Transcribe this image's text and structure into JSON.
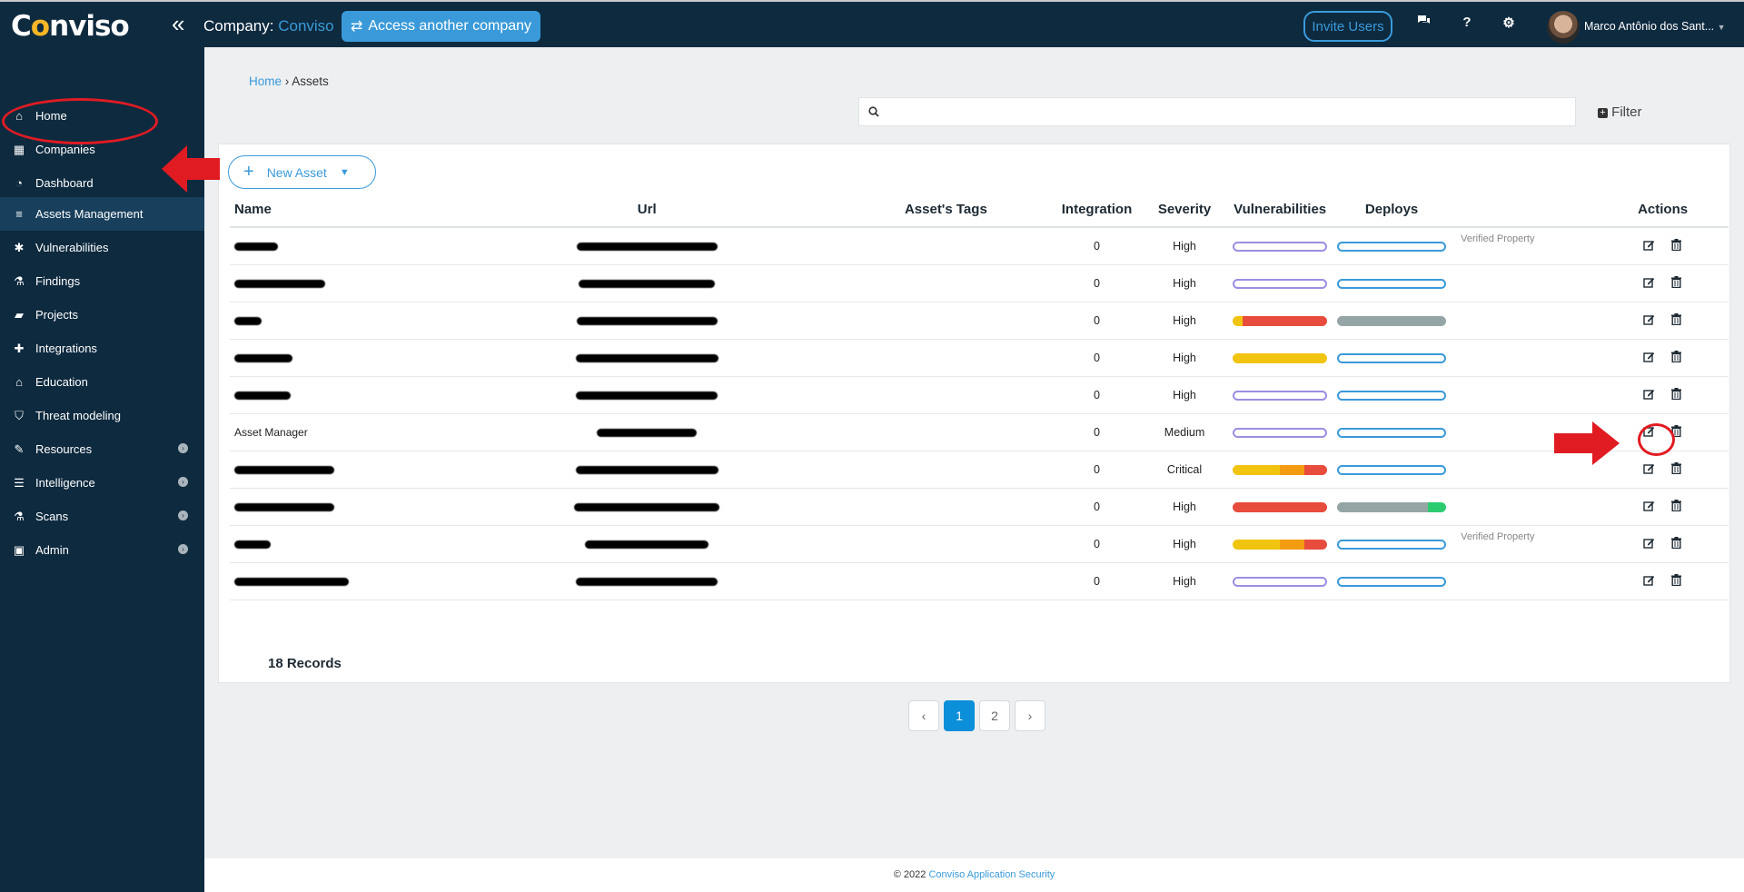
{
  "app": {
    "logo": "Conviso"
  },
  "topbar": {
    "company_label": "Company:",
    "company_name": "Conviso",
    "access_btn": "Access another company",
    "invite_btn": "Invite Users",
    "help": "?",
    "username": "Marco Antônio dos Sant..."
  },
  "sidebar": {
    "items": [
      {
        "label": "Home",
        "icon": "home-icon"
      },
      {
        "label": "Companies",
        "icon": "building-icon"
      },
      {
        "label": "Dashboard",
        "icon": "dashboard-icon"
      },
      {
        "label": "Assets Management",
        "icon": "server-icon"
      },
      {
        "label": "Vulnerabilities",
        "icon": "bug-icon"
      },
      {
        "label": "Findings",
        "icon": "flask-icon"
      },
      {
        "label": "Projects",
        "icon": "folder-icon"
      },
      {
        "label": "Integrations",
        "icon": "puzzle-icon"
      },
      {
        "label": "Education",
        "icon": "graduation-cap-icon"
      },
      {
        "label": "Threat modeling",
        "icon": "shield-icon"
      },
      {
        "label": "Resources",
        "icon": "wrench-icon"
      },
      {
        "label": "Intelligence",
        "icon": "database-icon"
      },
      {
        "label": "Scans",
        "icon": "flask-icon"
      },
      {
        "label": "Admin",
        "icon": "briefcase-icon"
      }
    ]
  },
  "breadcrumb": {
    "home": "Home",
    "current": "Assets"
  },
  "toolbar": {
    "filter": "Filter",
    "new_asset": "New Asset"
  },
  "table": {
    "headers": [
      "Name",
      "Url",
      "Asset's Tags",
      "Integration",
      "Severity",
      "Vulnerabilities",
      "Deploys",
      "Actions"
    ],
    "rows": [
      {
        "name": "",
        "integration": "0",
        "severity": "High",
        "verified": "Verified Property"
      },
      {
        "name": "",
        "integration": "0",
        "severity": "High",
        "verified": ""
      },
      {
        "name": "",
        "integration": "0",
        "severity": "High",
        "verified": ""
      },
      {
        "name": "",
        "integration": "0",
        "severity": "High",
        "verified": ""
      },
      {
        "name": "",
        "integration": "0",
        "severity": "High",
        "verified": ""
      },
      {
        "name": "Asset Manager",
        "integration": "0",
        "severity": "Medium",
        "verified": ""
      },
      {
        "name": "",
        "integration": "0",
        "severity": "Critical",
        "verified": ""
      },
      {
        "name": "",
        "integration": "0",
        "severity": "High",
        "verified": ""
      },
      {
        "name": "",
        "integration": "0",
        "severity": "High",
        "verified": "Verified Property"
      },
      {
        "name": "",
        "integration": "0",
        "severity": "High",
        "verified": ""
      }
    ]
  },
  "records": "18 Records",
  "pagination": {
    "pages": [
      "1",
      "2"
    ],
    "current": "1"
  },
  "footer": {
    "copyright": "© 2022",
    "link": "Conviso Application Security"
  },
  "colors": {
    "navy": "#0e2a3f",
    "accent": "#3a9ad9",
    "critical": "#e74c3c",
    "high": "#f39c12",
    "medium": "#f1c40f",
    "gray": "#95a5a6",
    "green": "#2ecc71",
    "annotation_red": "#e11b22"
  }
}
